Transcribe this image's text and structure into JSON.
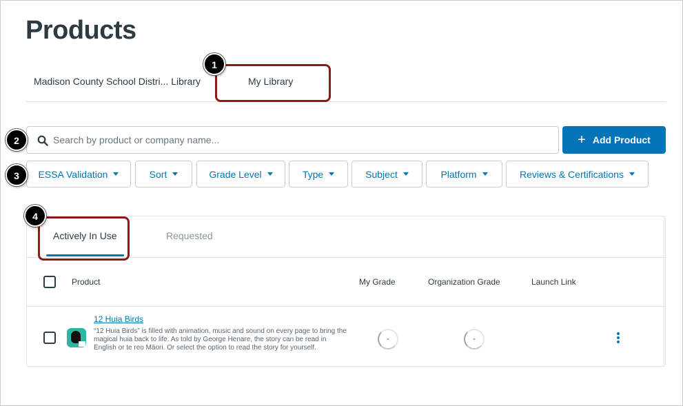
{
  "header": {
    "title": "Products"
  },
  "library_tabs": [
    {
      "label": "Madison County School Distri... Library"
    },
    {
      "label": "My Library"
    }
  ],
  "callouts": [
    "1",
    "2",
    "3",
    "4"
  ],
  "search": {
    "placeholder": "Search by product or company name...",
    "value": "",
    "icon": "search-icon"
  },
  "add_button": {
    "label": "Add Product",
    "icon": "plus-icon",
    "color": "#0374b5"
  },
  "filters": [
    {
      "label": "ESSA Validation"
    },
    {
      "label": "Sort"
    },
    {
      "label": "Grade Level"
    },
    {
      "label": "Type"
    },
    {
      "label": "Subject"
    },
    {
      "label": "Platform"
    },
    {
      "label": "Reviews & Certifications"
    }
  ],
  "sub_tabs": [
    {
      "label": "Actively In Use",
      "active": true
    },
    {
      "label": "Requested",
      "active": false
    }
  ],
  "table": {
    "columns": [
      "Product",
      "My Grade",
      "Organization Grade",
      "Launch Link"
    ],
    "rows": [
      {
        "name": "12 Huia Birds",
        "description": "“12 Huia Birds” is filled with animation, music and sound on every page to bring the magical huia back to life. As told by George Henare, the story can be read in English or te reo Māori. Or select the option to read the story for yourself.",
        "my_grade": "-",
        "org_grade": "-",
        "launch_link": ""
      }
    ]
  },
  "colors": {
    "accent": "#0374b5",
    "callout": "#8b1a1a",
    "text": "#2d3b45"
  }
}
